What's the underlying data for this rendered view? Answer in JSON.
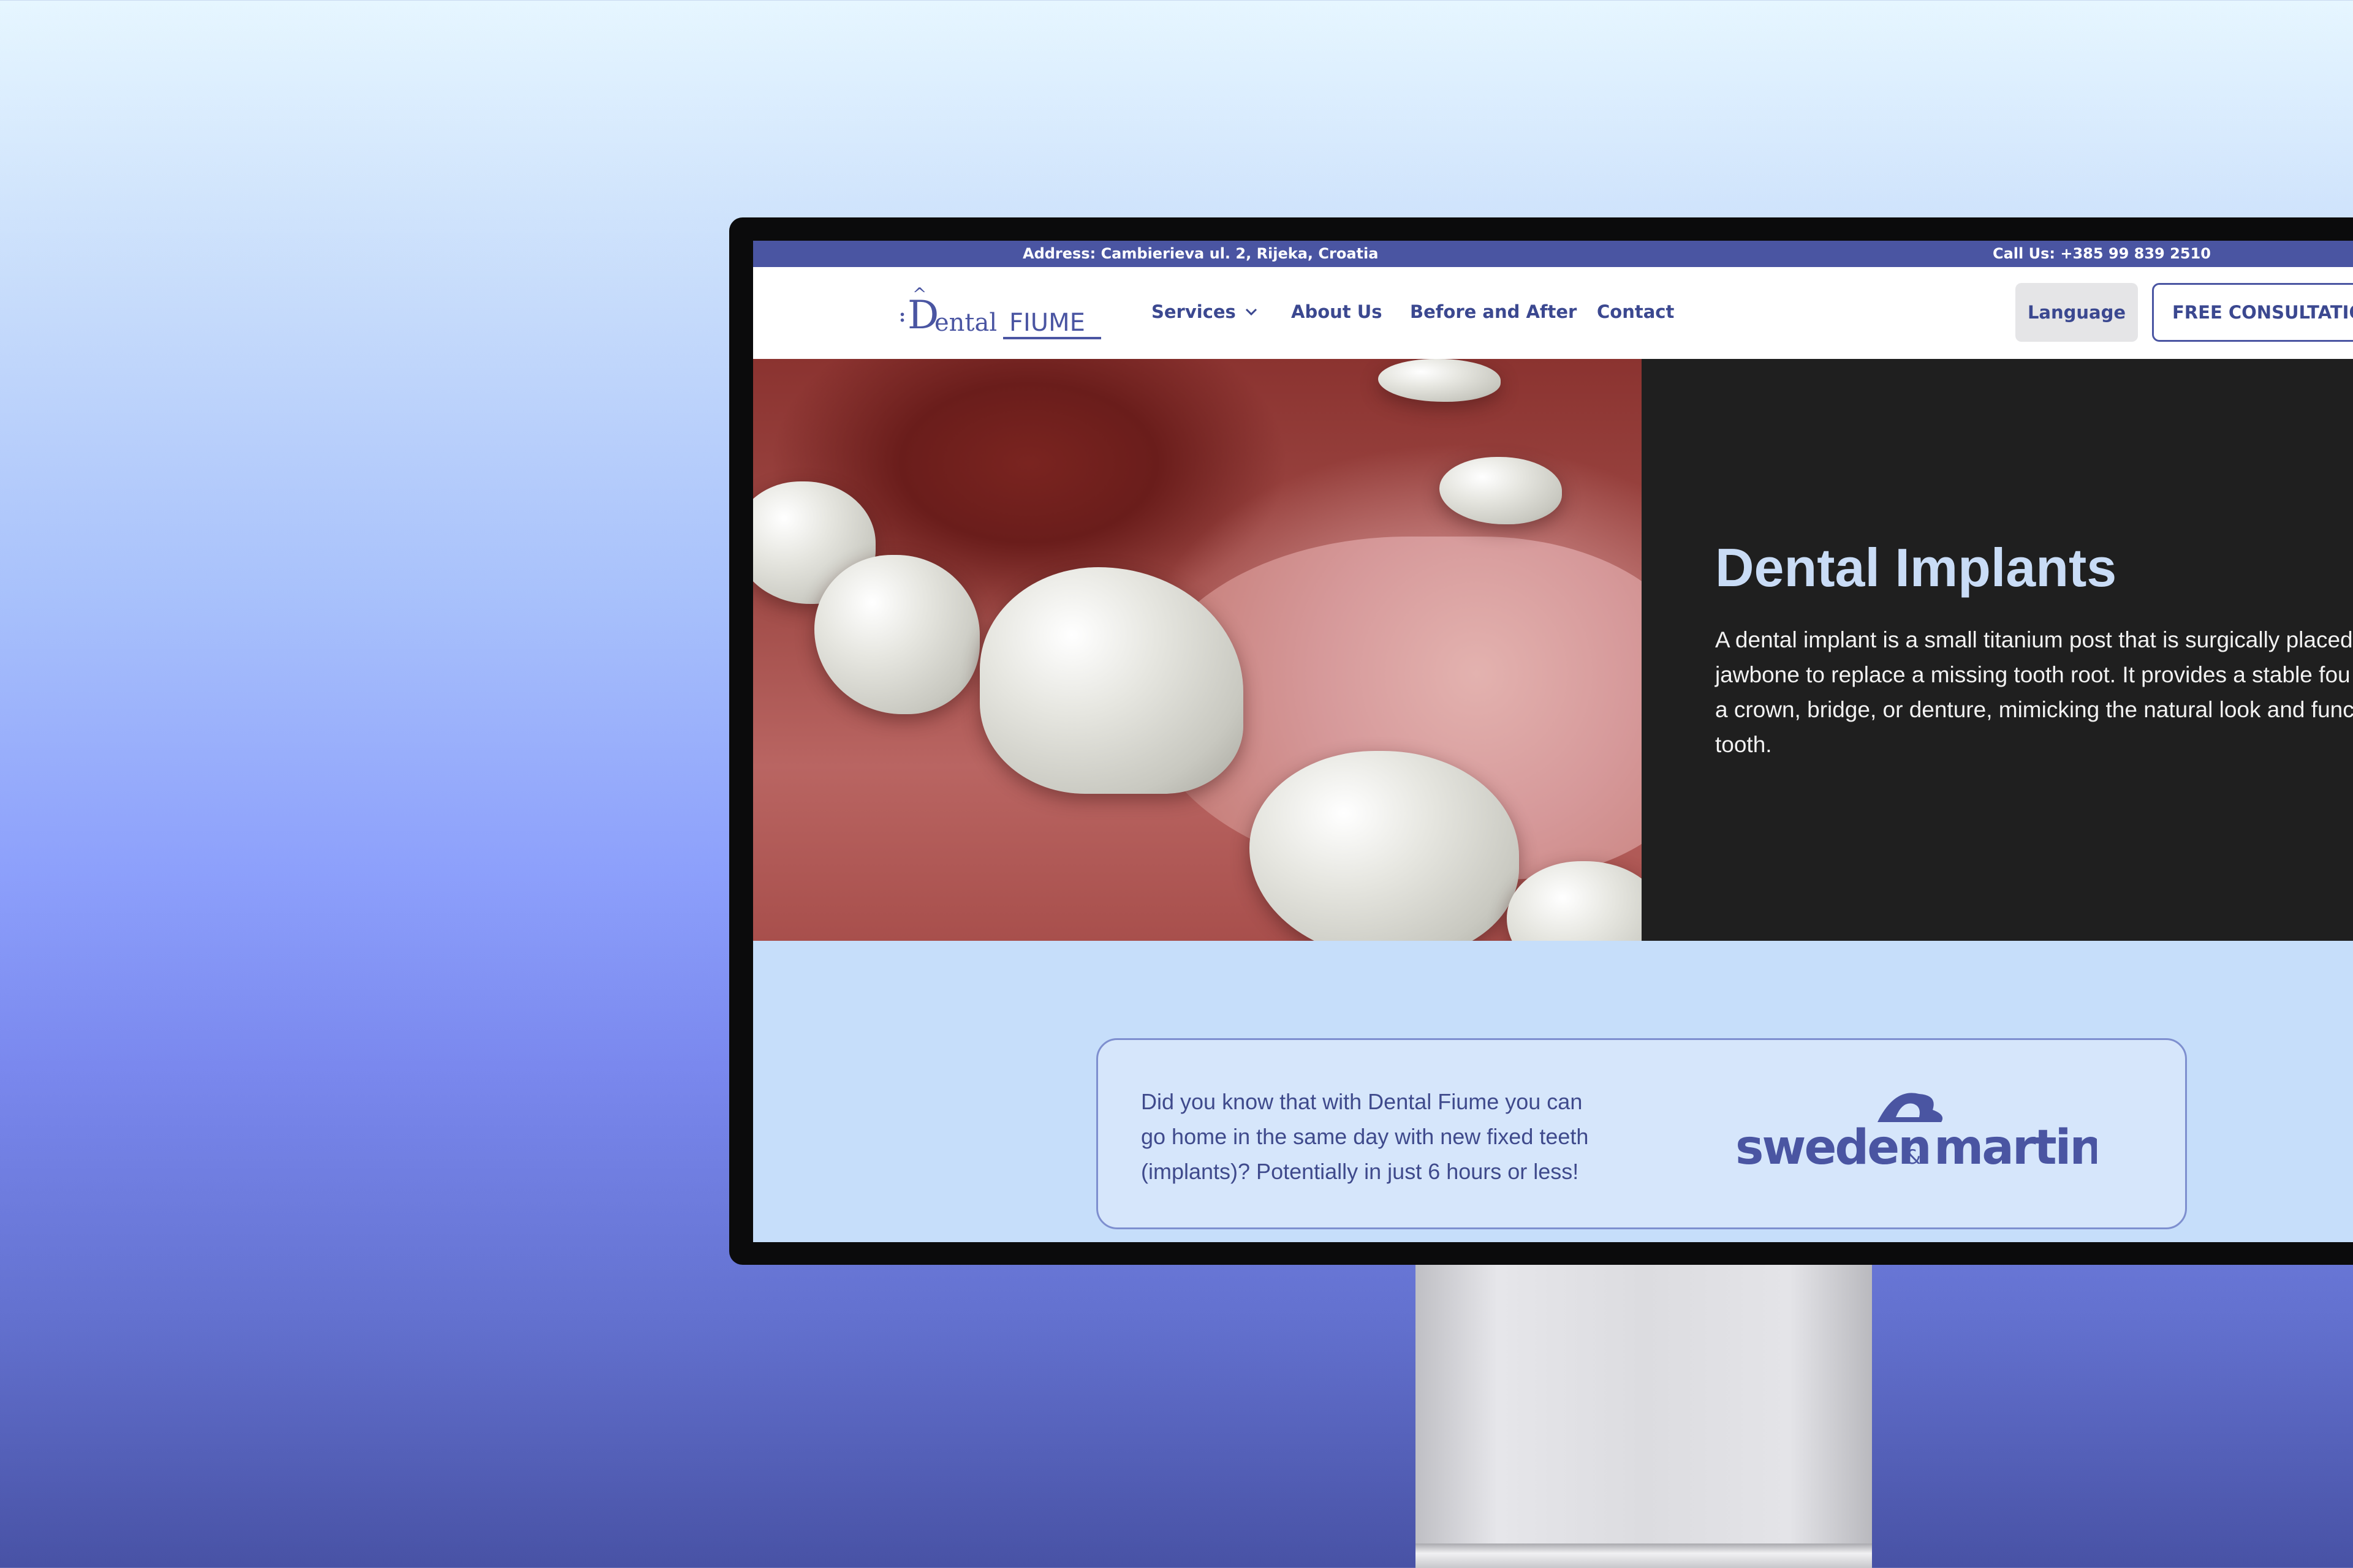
{
  "topbar": {
    "address": "Address: Cambierieva ul. 2, Rijeka, Croatia",
    "phone": "Call Us: +385 99 839 2510"
  },
  "logo": {
    "name": "Dental FIUME"
  },
  "nav": {
    "services": "Services",
    "about": "About Us",
    "before_after": "Before and After",
    "contact": "Contact",
    "language": "Language",
    "consultation": "FREE CONSULTATION"
  },
  "hero": {
    "title": "Dental Implants",
    "lines": [
      "A dental implant is a small titanium post that is surgically placed",
      "jawbone to replace a missing tooth root. It provides a stable fou",
      "a crown, bridge, or denture, mimicking the natural look and func",
      "tooth."
    ]
  },
  "info_card": {
    "lines": [
      "Did you know that with Dental Fiume you can",
      "go home in the same day with new fixed teeth",
      "(implants)? Potentially in just 6 hours or less!"
    ],
    "partner_logo": "sweden & martina"
  },
  "colors": {
    "brand": "#4a55a2",
    "hero_panel": "#1f1f1f",
    "hero_title": "#c9dcf6",
    "section_bg": "#c6defa"
  },
  "icons": {
    "services_dropdown": "chevron-down-icon"
  }
}
